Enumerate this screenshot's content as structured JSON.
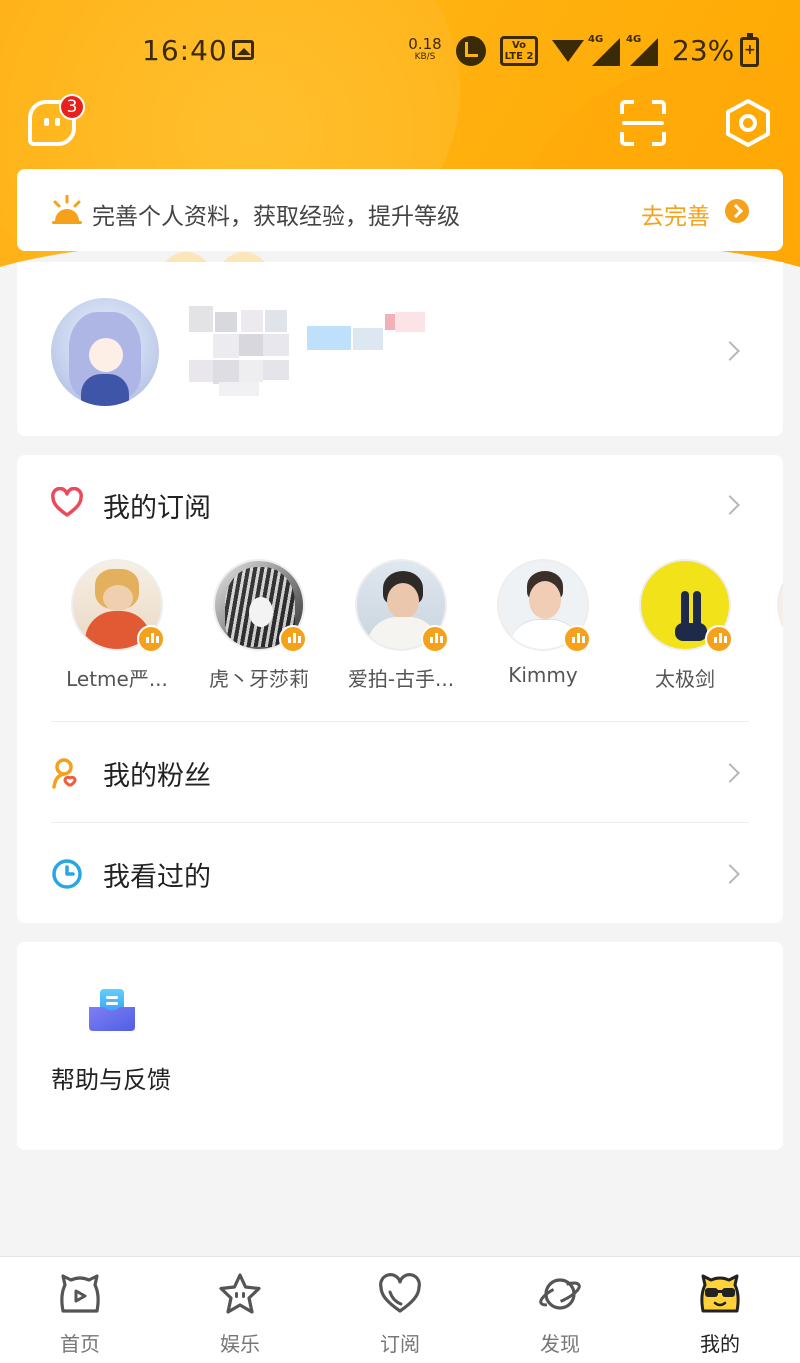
{
  "status_bar": {
    "time": "16:40",
    "net_speed_value": "0.18",
    "net_speed_unit": "KB/S",
    "volte_top": "Vo",
    "volte_bottom": "LTE 2",
    "sim1_tag": "4G",
    "sim2_tag": "4G",
    "battery": "23%"
  },
  "header": {
    "message_badge": "3",
    "icons": [
      "message-icon",
      "scan-icon",
      "settings-icon"
    ],
    "accent_color": "#FFB313"
  },
  "banner": {
    "text": "完善个人资料，获取经验，提升等级",
    "action": "去完善"
  },
  "subscriptions": {
    "title": "我的订阅",
    "items": [
      {
        "name": "Letme严..."
      },
      {
        "name": "虎丶牙莎莉"
      },
      {
        "name": "爱拍-古手..."
      },
      {
        "name": "Kimmy"
      },
      {
        "name": "太极剑"
      }
    ]
  },
  "menu": {
    "fans": "我的粉丝",
    "history": "我看过的"
  },
  "help": {
    "label": "帮助与反馈"
  },
  "bottom_nav": {
    "items": [
      {
        "label": "首页",
        "icon": "home-icon"
      },
      {
        "label": "娱乐",
        "icon": "star-face-icon"
      },
      {
        "label": "订阅",
        "icon": "heart-icon"
      },
      {
        "label": "发现",
        "icon": "planet-icon"
      },
      {
        "label": "我的",
        "icon": "sunglasses-face-icon"
      }
    ],
    "active": "我的"
  }
}
